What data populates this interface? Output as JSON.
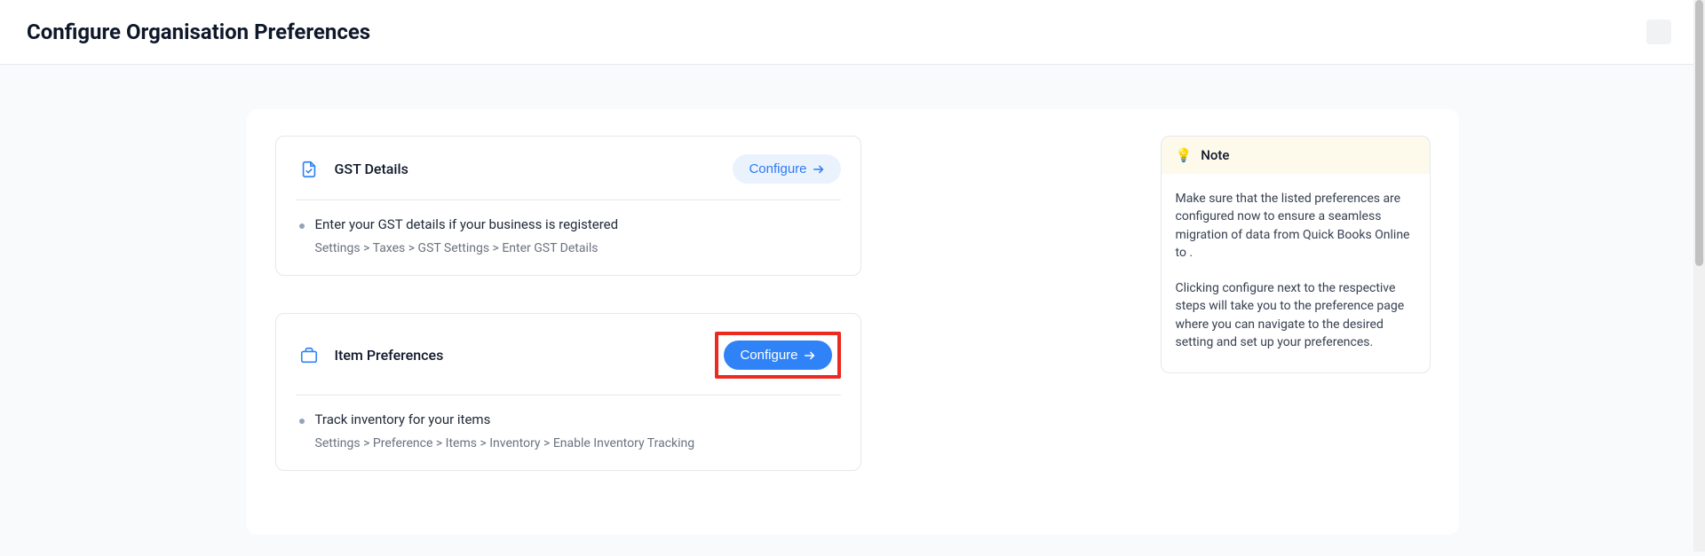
{
  "header": {
    "title": "Configure Organisation Preferences"
  },
  "cards": [
    {
      "title": "GST Details",
      "configure_label": "Configure",
      "item_text": "Enter your GST details if your business is registered",
      "path": "Settings > Taxes > GST Settings > Enter GST Details"
    },
    {
      "title": "Item Preferences",
      "configure_label": "Configure",
      "item_text": "Track inventory for your items",
      "path": "Settings > Preference > Items > Inventory > Enable Inventory Tracking"
    }
  ],
  "note": {
    "title": "Note",
    "para1": "Make sure that the listed preferences are configured now to ensure a seamless migration of data from Quick Books Online to .",
    "para2": "Clicking configure next to the respective steps will take you to the preference page where you can navigate to the desired setting and set up your preferences."
  }
}
